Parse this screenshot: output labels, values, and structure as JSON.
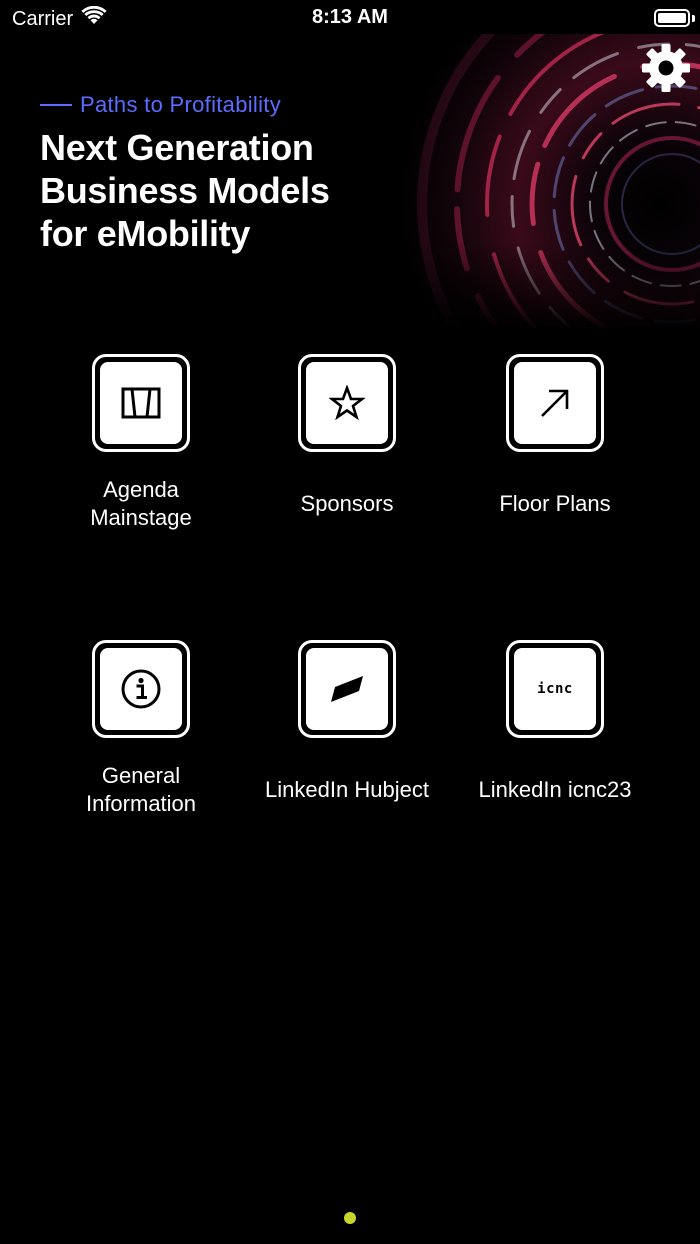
{
  "status_bar": {
    "carrier": "Carrier",
    "time": "8:13 AM",
    "battery_level": 1.0
  },
  "banner": {
    "subtitle": "Paths to Profitability",
    "headline_lines": [
      "Next Generation",
      "Business Models",
      "for eMobility"
    ]
  },
  "tiles": [
    {
      "label": "Agenda\nMainstage",
      "icon": "agenda-icon"
    },
    {
      "label": "Sponsors",
      "icon": "star-icon"
    },
    {
      "label": "Floor Plans",
      "icon": "arrow-up-right-icon"
    },
    {
      "label": "General\nInformation",
      "icon": "info-icon"
    },
    {
      "label": "LinkedIn Hubject",
      "icon": "hubject-logo-icon"
    },
    {
      "label": "LinkedIn icnc23",
      "icon": "icnc-logo-icon",
      "icon_text": "icnc"
    }
  ],
  "colors": {
    "background": "#000000",
    "subtitle_accent": "#5b6cff",
    "page_indicator": "#c8d62b"
  },
  "page_indicator": {
    "count": 1,
    "current": 1
  }
}
